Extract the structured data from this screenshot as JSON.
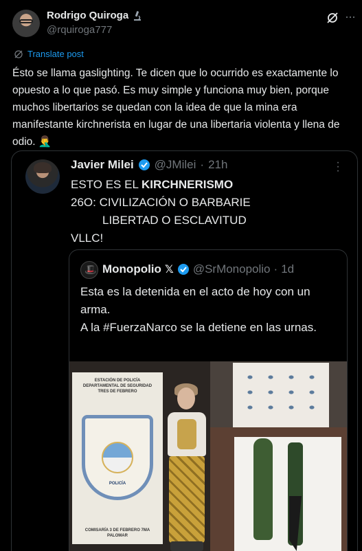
{
  "post": {
    "author_name": "Rodrigo Quiroga",
    "author_handle": "@rquiroga777",
    "translate_label": "Translate post",
    "text": "Ésto se llama gaslighting. Te dicen que lo ocurrido es exactamente lo opuesto a lo que pasó. Es muy simple y funciona muy bien, porque muchos libertarios se quedan con la idea de que la mina era manifestante kirchnerista en lugar de una libertaria violenta y llena de odio. 🤦‍♂️"
  },
  "quoted_post": {
    "author_name": "Javier Milei",
    "author_handle": "@JMilei",
    "time": "21h",
    "line1_prefix": "ESTO ES EL ",
    "line1_bold": "KIRCHNERISMO",
    "line2": "26O: CIVILIZACIÓN O BARBARIE",
    "line3": "LIBERTAD O ESCLAVITUD",
    "line4": "VLLC!"
  },
  "nested_quote": {
    "author_name": "Monopolio",
    "author_x": "𝕏",
    "author_handle": "@SrMonopolio",
    "time": "1d",
    "text_line1": "Esta es la detenida en el acto de hoy con un arma.",
    "text_line2": "A la #FuerzaNarco se la detiene en las urnas."
  },
  "photo": {
    "banner_top": "ESTACIÓN DE POLICÍA DEPARTAMENTAL DE SEGURIDAD TRES DE FEBRERO",
    "shield_text": "POLICÍA",
    "banner_bottom": "COMISARÍA 3 DE FEBRERO 7MA PALOMAR",
    "shield_ring_text": "PROVINCIA DE BUENOS AIRES"
  },
  "colors": {
    "background": "#000000",
    "text": "#e7e9ea",
    "muted": "#71767b",
    "accent": "#1d9bf0",
    "border": "#2f3336"
  }
}
